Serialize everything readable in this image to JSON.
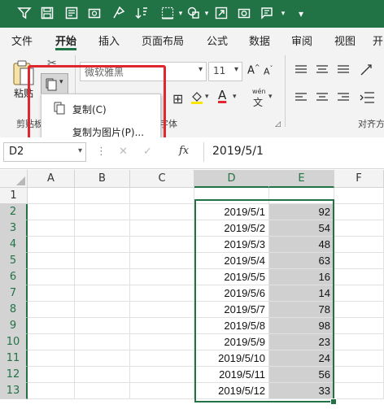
{
  "colors": {
    "brand": "#217346",
    "highlight": "#e0262e"
  },
  "quick_access": {
    "icons": [
      "filter-icon",
      "save-icon",
      "form-icon",
      "camera-icon",
      "format-painter-icon",
      "sort-icon",
      "borders-icon",
      "shapes-icon",
      "share-icon",
      "screenshot-icon",
      "symbols-icon"
    ]
  },
  "tabs": [
    "文件",
    "开始",
    "插入",
    "页面布局",
    "公式",
    "数据",
    "审阅",
    "视图",
    "开"
  ],
  "ribbon": {
    "paste_label": "粘贴",
    "clipboard_group": "剪贴板",
    "font_name": "微软雅黑",
    "font_size": "11",
    "font_group": "字体",
    "align_group": "对齐方",
    "wen": "wén",
    "wen_char": "文"
  },
  "context_menu": {
    "copy": "复制(C)",
    "copy_as_picture": "复制为图片(P)..."
  },
  "formula_bar": {
    "cell_ref": "D2",
    "fx": "fx",
    "value": "2019/5/1"
  },
  "grid": {
    "columns": [
      "A",
      "B",
      "C",
      "D",
      "E",
      "F"
    ],
    "rows": [
      {
        "num": "1",
        "date": "",
        "value": ""
      },
      {
        "num": "2",
        "date": "2019/5/1",
        "value": "92"
      },
      {
        "num": "3",
        "date": "2019/5/2",
        "value": "54"
      },
      {
        "num": "4",
        "date": "2019/5/3",
        "value": "48"
      },
      {
        "num": "5",
        "date": "2019/5/4",
        "value": "63"
      },
      {
        "num": "6",
        "date": "2019/5/5",
        "value": "16"
      },
      {
        "num": "7",
        "date": "2019/5/6",
        "value": "14"
      },
      {
        "num": "8",
        "date": "2019/5/7",
        "value": "78"
      },
      {
        "num": "9",
        "date": "2019/5/8",
        "value": "98"
      },
      {
        "num": "10",
        "date": "2019/5/9",
        "value": "23"
      },
      {
        "num": "11",
        "date": "2019/5/10",
        "value": "24"
      },
      {
        "num": "12",
        "date": "2019/5/11",
        "value": "56"
      },
      {
        "num": "13",
        "date": "2019/5/12",
        "value": "33"
      }
    ]
  }
}
